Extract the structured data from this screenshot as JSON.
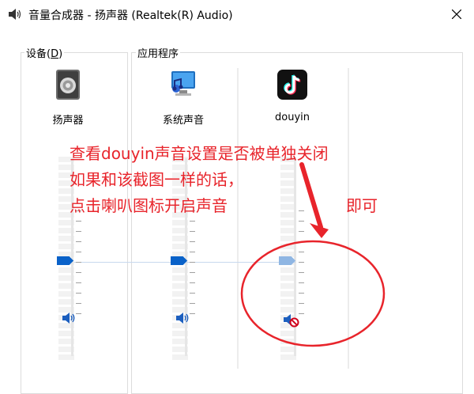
{
  "window": {
    "title": "音量合成器 - 扬声器 (Realtek(R) Audio)",
    "icon": "speaker-icon",
    "close_icon": "close-icon"
  },
  "groups": {
    "devices_title_main": "设备(",
    "devices_title_key": "D",
    "devices_title_end": ")",
    "apps_title": "应用程序"
  },
  "channels": [
    {
      "label": "扬声器",
      "icon": "speaker-device-icon",
      "volume_percent": 50,
      "muted": false
    },
    {
      "label": "系统声音",
      "icon": "system-sounds-icon",
      "volume_percent": 50,
      "muted": false
    },
    {
      "label": "douyin",
      "icon": "douyin-app-icon",
      "volume_percent": 50,
      "muted": true
    }
  ],
  "annotation": {
    "line1": "查看douyin声音设置是否被单独关闭",
    "line2": "如果和该截图一样的话，",
    "line3": "点击喇叭图标开启声音",
    "line3_tail": "即可"
  },
  "colors": {
    "accent": "#0a62c9",
    "annotation": "#e8242b",
    "mute_badge": "#d0021b"
  }
}
